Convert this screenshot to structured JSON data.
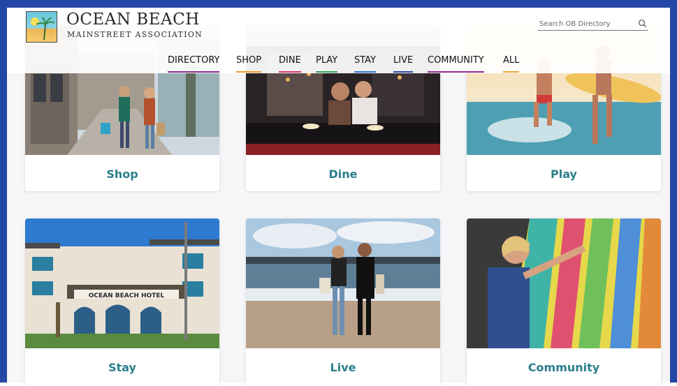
{
  "site": {
    "logo_title": "OCEAN BEACH",
    "logo_subtitle": "MAINSTREET  ASSOCIATION"
  },
  "search": {
    "placeholder": "Search OB Directory",
    "icon": "search-icon"
  },
  "nav": {
    "items": [
      {
        "label": "DIRECTORY",
        "accent": "#8b2a8b"
      },
      {
        "label": "SHOP",
        "accent": "#e89b2e"
      },
      {
        "label": "DINE",
        "accent": "#d6336c"
      },
      {
        "label": "PLAY",
        "accent": "#2fa25a"
      },
      {
        "label": "STAY",
        "accent": "#2f6fd6"
      },
      {
        "label": "LIVE",
        "accent": "#2347a5"
      },
      {
        "label": "COMMUNITY",
        "accent": "#8b2a8b"
      },
      {
        "label": "ALL",
        "accent": "#e8a62e"
      }
    ]
  },
  "cards": [
    {
      "label": "Shop",
      "photo": "shopping-street-photo"
    },
    {
      "label": "Dine",
      "photo": "dining-friends-photo"
    },
    {
      "label": "Play",
      "photo": "surf-beach-photo"
    },
    {
      "label": "Stay",
      "photo": "ocean-beach-hotel-photo"
    },
    {
      "label": "Live",
      "photo": "pier-walk-photo"
    },
    {
      "label": "Community",
      "photo": "mural-artist-photo"
    }
  ],
  "hotel_sign": "OCEAN BEACH HOTEL",
  "colors": {
    "frame": "#2347a5",
    "card_label": "#2b7f8a"
  }
}
